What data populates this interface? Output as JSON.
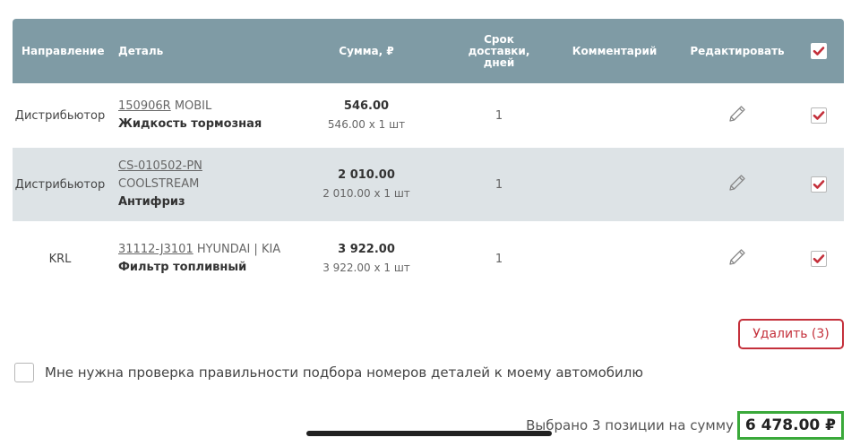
{
  "header": {
    "route": "Направление",
    "detail": "Деталь",
    "sum": "Сумма, ₽",
    "delivery": "Срок доставки, дней",
    "comment": "Комментарий",
    "edit": "Редактировать"
  },
  "rows": [
    {
      "route": "Дистрибьютор",
      "article": "150906R",
      "brand": "MOBIL",
      "name": "Жидкость тормозная",
      "total": "546.00",
      "unit": "546.00 x 1 шт",
      "days": "1"
    },
    {
      "route": "Дистрибьютор",
      "article": "CS-010502-PN",
      "brand": "COOLSTREAM",
      "name": "Антифриз",
      "total": "2 010.00",
      "unit": "2 010.00 x 1 шт",
      "days": "1"
    },
    {
      "route": "KRL",
      "article": "31112-J3101",
      "brand": "HYUNDAI | KIA",
      "name": "Фильтр топливный",
      "total": "3 922.00",
      "unit": "3 922.00 x 1 шт",
      "days": "1"
    }
  ],
  "delete_button": "Удалить (3)",
  "verify_label": "Мне нужна проверка правильности подбора номеров деталей к моему автомобилю",
  "summary_text": "Выбрано 3 позиции на сумму",
  "summary_total": "6 478.00 ₽",
  "colors": {
    "header_bg": "#7f9ba5",
    "alt_row_bg": "#dde3e6",
    "accent_red": "#c4303b",
    "highlight_green": "#3aa93a"
  },
  "icons": [
    "pencil-icon",
    "checkmark-icon"
  ]
}
